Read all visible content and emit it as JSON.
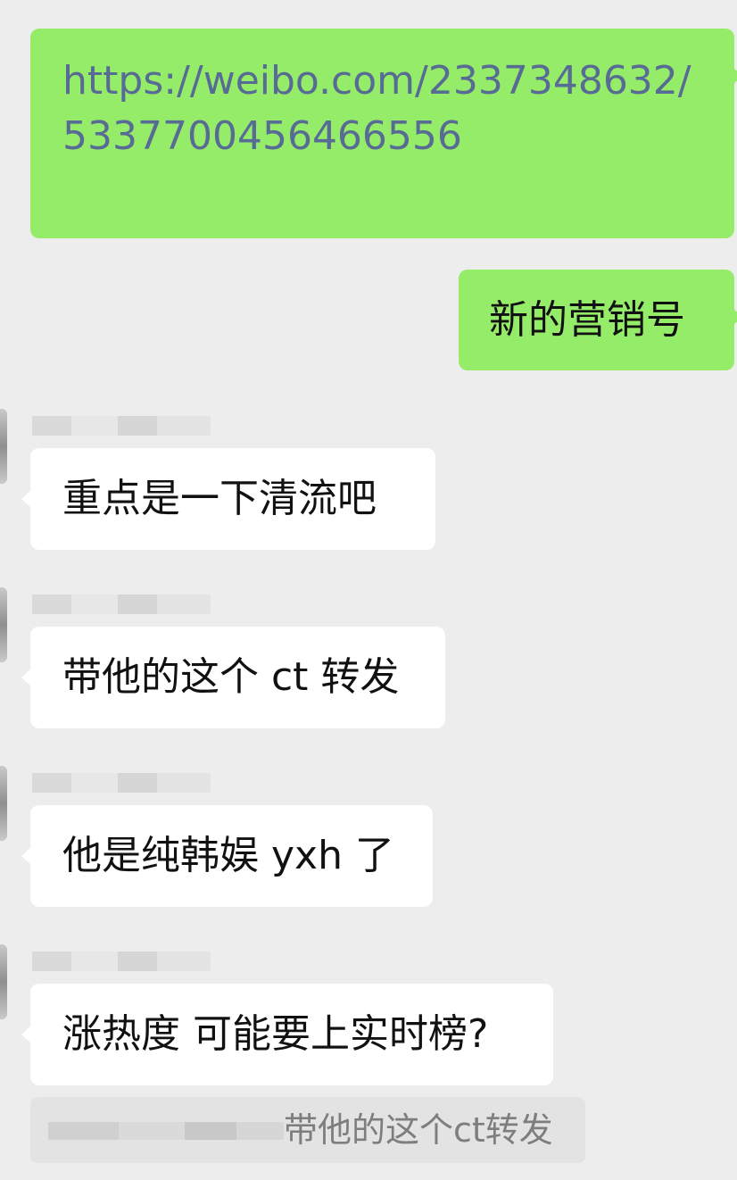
{
  "messages": [
    {
      "direction": "outgoing",
      "type": "link",
      "text": "https://weibo.com/2337348632/5337700456466556"
    },
    {
      "direction": "outgoing",
      "type": "text",
      "text": "新的营销号"
    },
    {
      "direction": "incoming",
      "type": "text",
      "text": "重点是一下清流吧"
    },
    {
      "direction": "incoming",
      "type": "text",
      "text": "带他的这个 ct 转发"
    },
    {
      "direction": "incoming",
      "type": "text",
      "text": "他是纯韩娱 yxh 了"
    },
    {
      "direction": "incoming",
      "type": "text",
      "text": "涨热度 可能要上实时榜?"
    }
  ],
  "quote": {
    "text": "带他的这个ct转发"
  },
  "colors": {
    "background": "#ededed",
    "outgoing_bubble": "#95ec69",
    "incoming_bubble": "#ffffff",
    "link": "#576b95",
    "quote_background": "#e3e3e3"
  }
}
